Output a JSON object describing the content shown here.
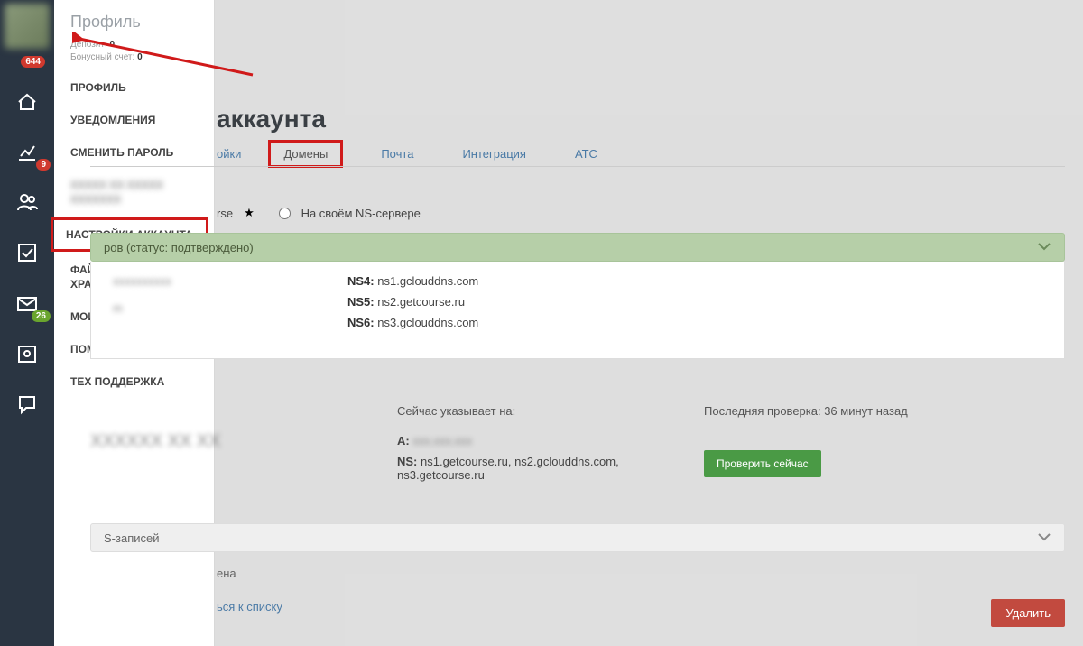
{
  "sidebar_badges": {
    "top": "644",
    "chart": "9",
    "mail": "26"
  },
  "profile": {
    "title": "Профиль",
    "deposit_label": "Депозит:",
    "deposit_val": "0",
    "bonus_label": "Бонусный счет:",
    "bonus_val": "0",
    "items": [
      "ПРОФИЛЬ",
      "УВЕДОМЛЕНИЯ",
      "СМЕНИТЬ ПАРОЛЬ",
      "",
      "НАСТРОЙКИ АККАУНТА",
      "ФАЙЛОВОЕ ХРАНИЛИЩЕ",
      "МОИ АККАУНТЫ",
      "ПОМОЩЬ",
      "ТЕХ ПОДДЕРЖКА"
    ]
  },
  "page": {
    "heading": "аккаунта",
    "tabs": {
      "partial": "ойки",
      "active": "Домены",
      "mail": "Почта",
      "integr": "Интеграция",
      "ats": "АТС"
    },
    "radio": {
      "frag": "rse",
      "own": "На своём NS-сервере"
    },
    "greenbar": "ров (статус: подтверждено)",
    "ns": {
      "l": "m",
      "r4l": "NS4:",
      "r4v": "ns1.gclouddns.com",
      "r5l": "NS5:",
      "r5v": "ns2.getcourse.ru",
      "r6l": "NS6:",
      "r6v": "ns3.gclouddns.com"
    },
    "points_to": "Сейчас указывает на:",
    "a_label": "A:",
    "a_val": "",
    "ns_label": "NS:",
    "ns_val": "ns1.getcourse.ru, ns2.gclouddns.com, ns3.getcourse.ru",
    "last_check": "Последняя проверка: 36 минут назад",
    "check_btn": "Проверить сейчас",
    "greybar": "S-записей",
    "frag_ena": "ена",
    "back": "ься к списку",
    "delete": "Удалить"
  }
}
